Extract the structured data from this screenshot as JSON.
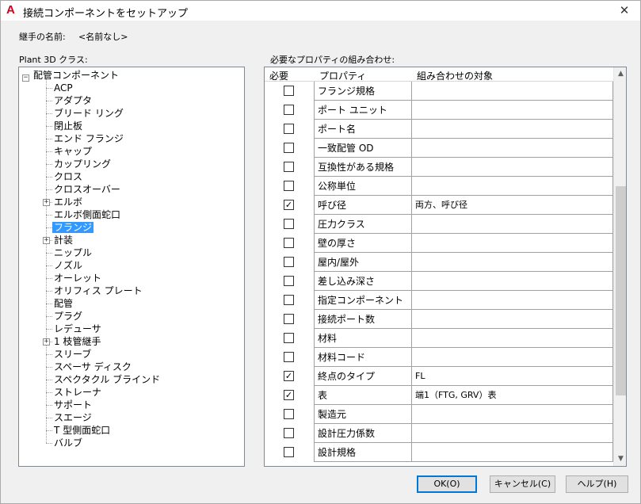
{
  "window": {
    "title": "接続コンポーネントをセットアップ",
    "close_glyph": "✕",
    "logo_letter": "A"
  },
  "joint_name": {
    "label": "継手の名前:",
    "value": "<名前なし>"
  },
  "class_section": {
    "label": "Plant 3D クラス:"
  },
  "props_section": {
    "label": "必要なプロパティの組み合わせ:"
  },
  "tree": {
    "root": "配管コンポーネント",
    "items": [
      {
        "label": "ACP",
        "expandable": false
      },
      {
        "label": "アダプタ",
        "expandable": false
      },
      {
        "label": "ブリード リング",
        "expandable": false
      },
      {
        "label": "閉止板",
        "expandable": false
      },
      {
        "label": "エンド フランジ",
        "expandable": false
      },
      {
        "label": "キャップ",
        "expandable": false
      },
      {
        "label": "カップリング",
        "expandable": false
      },
      {
        "label": "クロス",
        "expandable": false
      },
      {
        "label": "クロスオーバー",
        "expandable": false
      },
      {
        "label": "エルボ",
        "expandable": true
      },
      {
        "label": "エルボ側面蛇口",
        "expandable": false
      },
      {
        "label": "フランジ",
        "expandable": false,
        "selected": true
      },
      {
        "label": "計装",
        "expandable": true
      },
      {
        "label": "ニップル",
        "expandable": false
      },
      {
        "label": "ノズル",
        "expandable": false
      },
      {
        "label": "オーレット",
        "expandable": false
      },
      {
        "label": "オリフィス プレート",
        "expandable": false
      },
      {
        "label": "配管",
        "expandable": false
      },
      {
        "label": "プラグ",
        "expandable": false
      },
      {
        "label": "レデューサ",
        "expandable": false
      },
      {
        "label": "1 枝管継手",
        "expandable": true
      },
      {
        "label": "スリーブ",
        "expandable": false
      },
      {
        "label": "スペーサ ディスク",
        "expandable": false
      },
      {
        "label": "スペクタクル ブラインド",
        "expandable": false
      },
      {
        "label": "ストレーナ",
        "expandable": false
      },
      {
        "label": "サポート",
        "expandable": false
      },
      {
        "label": "スエージ",
        "expandable": false
      },
      {
        "label": "T 型側面蛇口",
        "expandable": false
      },
      {
        "label": "バルブ",
        "expandable": false
      }
    ]
  },
  "grid": {
    "headers": {
      "required": "必要",
      "property": "プロパティ",
      "target": "組み合わせの対象"
    },
    "rows": [
      {
        "checked": false,
        "property": "フランジ規格",
        "target": ""
      },
      {
        "checked": false,
        "property": "ポート ユニット",
        "target": ""
      },
      {
        "checked": false,
        "property": "ポート名",
        "target": ""
      },
      {
        "checked": false,
        "property": "一致配管 OD",
        "target": ""
      },
      {
        "checked": false,
        "property": "互換性がある規格",
        "target": ""
      },
      {
        "checked": false,
        "property": "公称単位",
        "target": ""
      },
      {
        "checked": true,
        "property": "呼び径",
        "target": "両方、呼び径"
      },
      {
        "checked": false,
        "property": "圧力クラス",
        "target": ""
      },
      {
        "checked": false,
        "property": "壁の厚さ",
        "target": ""
      },
      {
        "checked": false,
        "property": "屋内/屋外",
        "target": ""
      },
      {
        "checked": false,
        "property": "差し込み深さ",
        "target": ""
      },
      {
        "checked": false,
        "property": "指定コンポーネント",
        "target": ""
      },
      {
        "checked": false,
        "property": "接続ポート数",
        "target": ""
      },
      {
        "checked": false,
        "property": "材料",
        "target": ""
      },
      {
        "checked": false,
        "property": "材料コード",
        "target": ""
      },
      {
        "checked": true,
        "property": "終点のタイプ",
        "target": "FL"
      },
      {
        "checked": true,
        "property": "表",
        "target": "端1（FTG, GRV）表"
      },
      {
        "checked": false,
        "property": "製造元",
        "target": ""
      },
      {
        "checked": false,
        "property": "設計圧力係数",
        "target": ""
      },
      {
        "checked": false,
        "property": "設計規格",
        "target": ""
      }
    ],
    "check_glyph": "✓",
    "scroll_up_glyph": "▲",
    "scroll_down_glyph": "▼"
  },
  "buttons": {
    "ok": "OK(O)",
    "cancel": "キャンセル(C)",
    "help": "ヘルプ(H)"
  }
}
